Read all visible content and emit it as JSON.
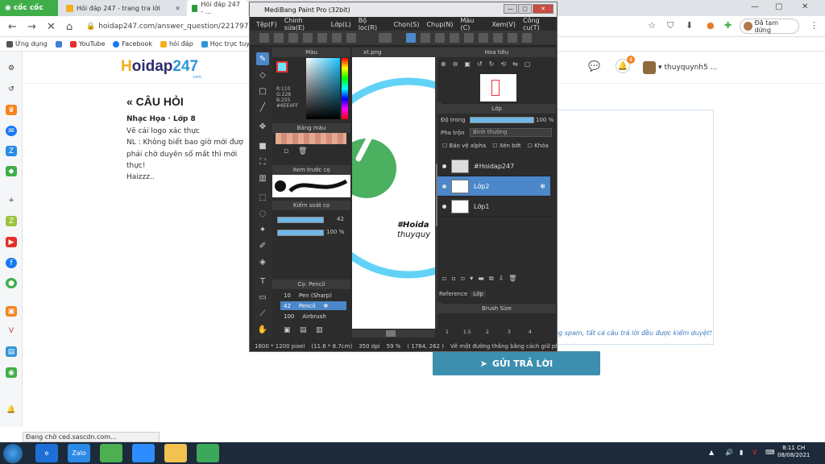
{
  "browser": {
    "brand": "cốc cốc",
    "tabs": [
      {
        "label": "Hỏi đáp 247 - trang tra lời"
      },
      {
        "label": "Hỏi đáp 247 - ..."
      }
    ],
    "url": "hoidap247.com/answer_question/2217970",
    "paused_label": "Đã tạm dừng",
    "bookmarks": [
      {
        "label": "Ứng dụng",
        "color": "#555555"
      },
      {
        "label": "",
        "color": "#3d7fd8"
      },
      {
        "label": "YouTube",
        "color": "#e52d27"
      },
      {
        "label": "Facebook",
        "color": "#1877f2"
      },
      {
        "label": "hỏi đáp",
        "color": "#f2b01e"
      },
      {
        "label": "Học trực tuyến OLM...",
        "color": "#2f96d8"
      }
    ],
    "status_text": "Đang chờ ced.sascdn.com..."
  },
  "site": {
    "logo_h": "H",
    "logo_rest": "oidap",
    "logo_num": "247",
    "logo_sub": ".com",
    "notification_count": "4",
    "username": "thuyquynh5 ...",
    "question_heading": "« CÂU HỎI",
    "subject_line": "Nhạc Họa · Lớp 8",
    "question_lines": [
      "Vẽ cái logo xác thực",
      "NL : Không biết bao giờ mới đượ",
      "phải chờ duyên số mất thì mới",
      "thực!",
      "Haizzz.."
    ],
    "answer_note": "ng spam, tất cả câu trả lời đều được kiểm duyệt!",
    "submit_label": "GỬI TRẢ LỜI"
  },
  "medibang": {
    "title": "MediBang Paint Pro (32bit)",
    "menu": [
      "Tệp(F)",
      "Chỉnh sửa(E)",
      "Lớp(L)",
      "Bộ lọc(R)",
      "Chọn(S)",
      "Chụp(N)",
      "Màu (C)",
      "Xem(V)",
      "Công cụ(T)"
    ],
    "panels": {
      "color": "Màu",
      "palette": "Bảng màu",
      "preview": "Xem trước cọ",
      "control": "Kiểm soát cọ",
      "brush": "Cọ: Pencil",
      "navigator": "Hoa tiêu",
      "layer": "Lớp",
      "brush_size": "Brush Size"
    },
    "rgb_lines": [
      "R:110",
      "G:228",
      "B:255",
      "#6EE4FF"
    ],
    "brush_size_value": "42",
    "opacity_value": "100 %",
    "brushes": [
      {
        "size": "10",
        "name": "Pen (Sharp)"
      },
      {
        "size": "42",
        "name": "Pencil"
      },
      {
        "size": "100",
        "name": "Airbrush"
      }
    ],
    "canvas_tab": "xt.png",
    "canvas_text": [
      "#Hoida",
      "thuyquy"
    ],
    "layer_opacity_label": "Độ trong",
    "layer_opacity_value": "100 %",
    "blend_label": "Pha trộn",
    "blend_value": "Bình thường",
    "layer_options": [
      "Bảo vệ alpha",
      "Xén bớt",
      "Khóa"
    ],
    "layers": [
      {
        "name": "#Hoidap247"
      },
      {
        "name": "Lớp2"
      },
      {
        "name": "Lớp1"
      }
    ],
    "bottom_tabs": [
      "Reference",
      "Lớp"
    ],
    "brush_sizes": [
      "1",
      "1.5",
      "2",
      "3",
      "4"
    ],
    "status": [
      "1600 * 1200 pixel",
      "(11.6 * 8.7cm)",
      "350 dpi",
      "59 %",
      "( 1764, 262 )",
      "Vẽ một đường thẳng bằng cách giữ phím Shi"
    ]
  },
  "taskbar": {
    "apps": [
      {
        "label": "e",
        "color": "#1d6fd6"
      },
      {
        "label": "Zalo",
        "color": "#2a8ae6"
      },
      {
        "label": "",
        "color": "#4caf50"
      },
      {
        "label": "",
        "color": "#2d8cff"
      },
      {
        "label": "",
        "color": "#f1c24f"
      },
      {
        "label": "",
        "color": "#3ca85a"
      }
    ],
    "time": "8:11 CH",
    "date": "08/08/2021"
  },
  "colors": {
    "accent": "#3d8fb0",
    "selection": "#4b87c9",
    "brush_color": "#6EE4FF",
    "leaf": "#4bb05f"
  }
}
